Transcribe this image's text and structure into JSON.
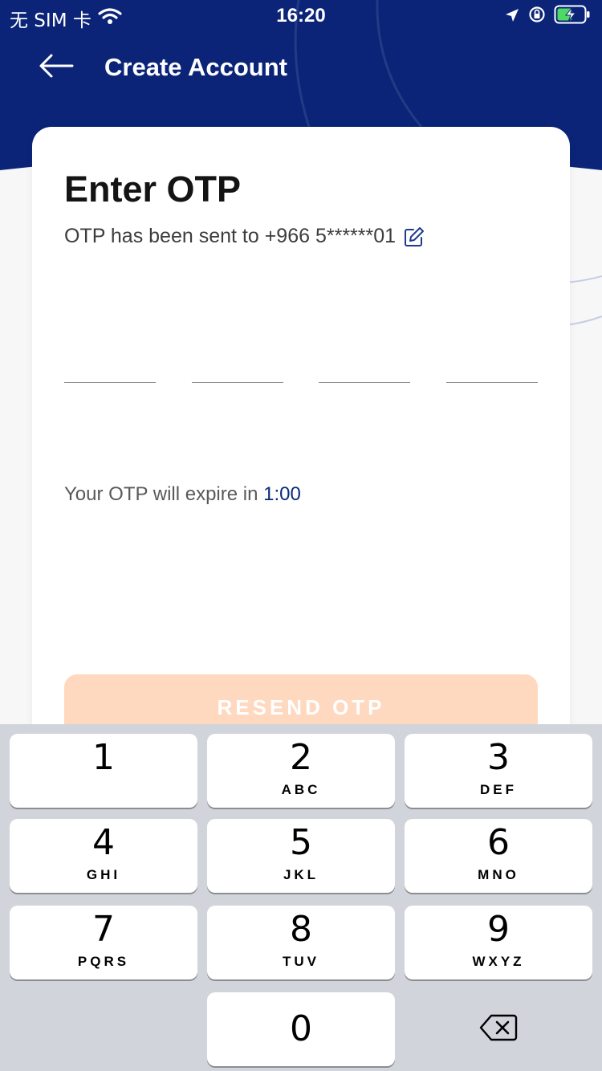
{
  "colors": {
    "header_blue": "#0b2478",
    "resend_button": "#ffd8c0",
    "timer_text": "#0a2a7a",
    "keyboard_bg": "#d1d4da"
  },
  "status_bar": {
    "carrier": "无 SIM 卡",
    "time": "16:20",
    "icons": [
      "wifi-icon",
      "location-arrow-icon",
      "orientation-lock-icon",
      "battery-charging-icon"
    ]
  },
  "header": {
    "back_icon": "arrow-left-icon",
    "title": "Create Account"
  },
  "otp": {
    "title": "Enter OTP",
    "subtitle": "OTP has been sent to +966 5******01",
    "edit_icon": "edit-icon",
    "digit_count": 4,
    "expire_label": "Your OTP will expire in",
    "timer": "1:00"
  },
  "resend": {
    "label": "RESEND OTP"
  },
  "keyboard": {
    "keys": [
      {
        "digit": "1",
        "letters": ""
      },
      {
        "digit": "2",
        "letters": "ABC"
      },
      {
        "digit": "3",
        "letters": "DEF"
      },
      {
        "digit": "4",
        "letters": "GHI"
      },
      {
        "digit": "5",
        "letters": "JKL"
      },
      {
        "digit": "6",
        "letters": "MNO"
      },
      {
        "digit": "7",
        "letters": "PQRS"
      },
      {
        "digit": "8",
        "letters": "TUV"
      },
      {
        "digit": "9",
        "letters": "WXYZ"
      },
      {
        "digit": "0",
        "letters": ""
      }
    ],
    "delete_icon": "backspace-icon"
  }
}
